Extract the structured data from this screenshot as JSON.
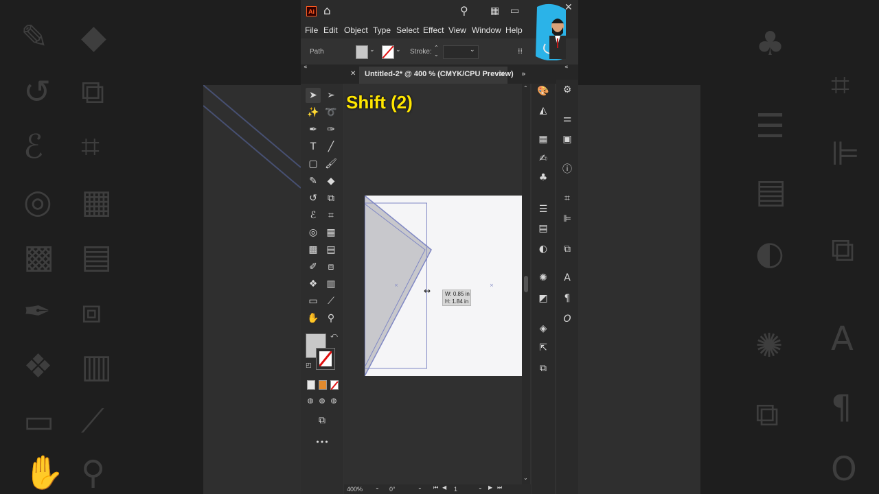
{
  "app": {
    "logo": "Ai"
  },
  "menu": [
    "File",
    "Edit",
    "Object",
    "Type",
    "Select",
    "Effect",
    "View",
    "Window",
    "Help"
  ],
  "control_bar": {
    "selection_label": "Path",
    "stroke_label": "Stroke:"
  },
  "document_tab": {
    "title": "Untitled-2* @ 400 % (CMYK/CPU Preview)"
  },
  "overlay": {
    "caption": "Shift (2)"
  },
  "tooltip": {
    "width": "W: 0.85 in",
    "height": "H: 1.84 in"
  },
  "status_bar": {
    "zoom": "400%",
    "rotation": "0°",
    "artboard_number": "1"
  },
  "colors": {
    "caption": "#ffe600",
    "shape_fill": "#c8c8cc",
    "shape_stroke": "#7f87c4",
    "artboard": "#f5f5f7",
    "logo_accent": "#ff5a1f"
  },
  "icons": {
    "titlebar": [
      "home-icon",
      "search-icon",
      "arrange-documents-icon",
      "screen-mode-icon",
      "close-icon"
    ],
    "tools": [
      "selection-tool-icon",
      "direct-selection-tool-icon",
      "magic-wand-tool-icon",
      "lasso-tool-icon",
      "pen-tool-icon",
      "curvature-tool-icon",
      "type-tool-icon",
      "line-segment-tool-icon",
      "rectangle-tool-icon",
      "paintbrush-tool-icon",
      "shaper-tool-icon",
      "eraser-tool-icon",
      "rotate-tool-icon",
      "scale-tool-icon",
      "width-tool-icon",
      "free-transform-tool-icon",
      "shape-builder-tool-icon",
      "perspective-grid-tool-icon",
      "mesh-tool-icon",
      "gradient-tool-icon",
      "eyedropper-tool-icon",
      "blend-tool-icon",
      "symbol-sprayer-tool-icon",
      "column-graph-tool-icon",
      "artboard-tool-icon",
      "slice-tool-icon",
      "hand-tool-icon",
      "zoom-tool-icon",
      "fill-stroke-icon",
      "color-mode-icon",
      "gradient-mode-icon",
      "none-mode-icon",
      "draw-normal-icon",
      "draw-behind-icon",
      "draw-inside-icon",
      "screen-mode-icon",
      "edit-toolbar-icon"
    ],
    "panels": [
      "color-icon",
      "color-guide-icon",
      "swatches-icon",
      "brushes-icon",
      "symbols-icon",
      "stroke-icon",
      "gradient-icon",
      "transparency-icon",
      "appearance-icon",
      "graphic-styles-icon",
      "layers-icon",
      "asset-export-icon",
      "artboards-icon",
      "properties-icon",
      "libraries-icon",
      "attributes-icon",
      "info-icon",
      "transform-icon",
      "align-icon",
      "pathfinder-icon",
      "character-icon",
      "paragraph-icon",
      "opentype-icon"
    ]
  }
}
